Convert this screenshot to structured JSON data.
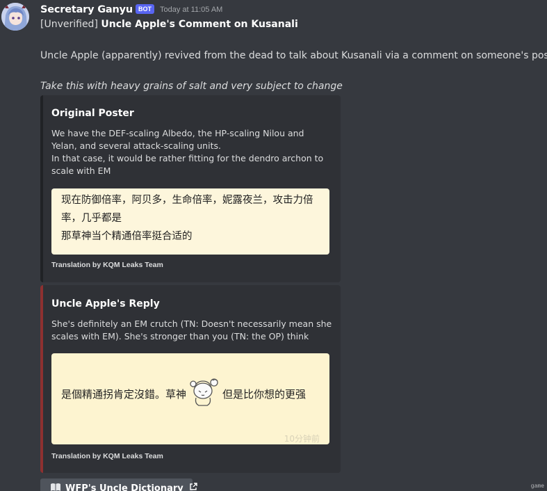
{
  "message": {
    "author": "Secretary Ganyu",
    "bot_tag": "BOT",
    "timestamp": "Today at 11:05 AM",
    "title_prefix": "[Unverified] ",
    "title_bold": "Uncle Apple's Comment on Kusanali",
    "line2": "Uncle Apple (apparently) revived from the dead to talk about Kusanali via a comment on someone's post",
    "line3": "Take this with heavy grains of salt and very subject to change"
  },
  "embeds": [
    {
      "title": "Original Poster",
      "description_1": "We have the DEF-scaling Albedo, the HP-scaling Nilou and Yelan, and several attack-scaling units.",
      "description_2": "In that case, it would be rather fitting for the dendro archon to scale with EM",
      "image_text_1": "现在防御倍率，阿贝多，生命倍率，妮露夜兰，攻击力倍率，几乎都是",
      "image_text_2": "那草神当个精通倍率挺合适的",
      "footer": "Translation by KQM Leaks Team",
      "accent": "#202225"
    },
    {
      "title": "Uncle Apple's Reply",
      "description": "She's definitely an EM crutch (TN: Doesn't necessarily mean she scales with EM). She's stronger than you (TN: the OP) think",
      "image_text_a": "是個精通拐肯定沒錯。草神",
      "image_text_b": "但是比你想的更强",
      "image_faded": "10分钟前",
      "footer": "Translation by KQM Leaks Team",
      "accent": "#8e3030"
    }
  ],
  "link_button": {
    "icon": "book-icon",
    "label": "WFP's Uncle Dictionary",
    "trail_icon": "external-link-icon"
  },
  "watermark": "game"
}
